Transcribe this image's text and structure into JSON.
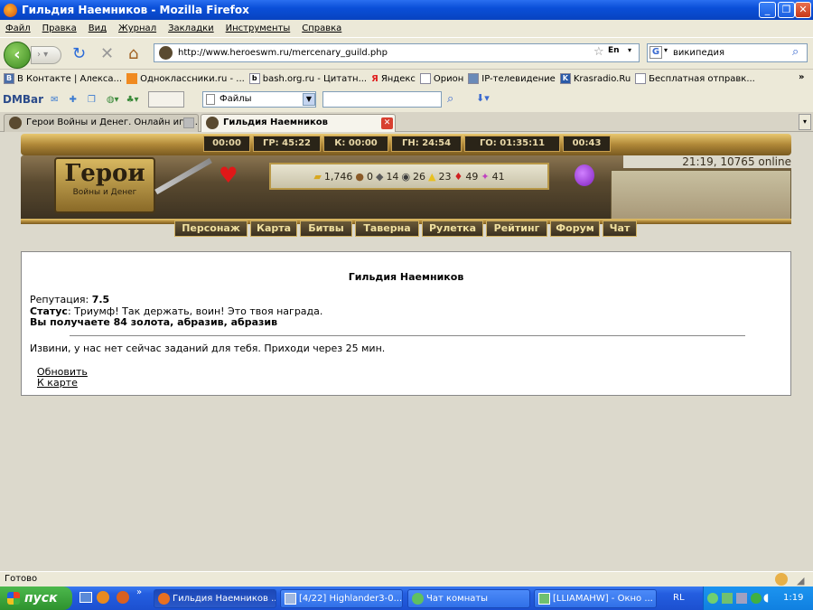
{
  "browser": {
    "title": "Гильдия Наемников - Mozilla Firefox",
    "menu": [
      "Файл",
      "Правка",
      "Вид",
      "Журнал",
      "Закладки",
      "Инструменты",
      "Справка"
    ],
    "url": "http://www.heroeswm.ru/mercenary_guild.php",
    "search_value": "википедия",
    "lang_badge": "En",
    "bookmarks": [
      "В Контакте | Алекса...",
      "Одноклассники.ru - ...",
      "bash.org.ru - Цитатн...",
      "Яндекс",
      "Орион",
      "IP-телевидение",
      "Krasradio.Ru",
      "Бесплатная отправк..."
    ],
    "dmbar_label": "DMBar",
    "files_combo": "Файлы",
    "tabs": [
      {
        "label": "Герои Войны и Денег. Онлайн игра.",
        "active": false
      },
      {
        "label": "Гильдия Наемников",
        "active": true
      }
    ],
    "status": "Готово"
  },
  "game": {
    "logo_text": "Герои",
    "logo_sub": "Войны и Денег",
    "timers": [
      "00:00",
      "ГР: 45:22",
      "К: 00:00",
      "ГН: 24:54",
      "ГО: 01:35:11",
      "00:43"
    ],
    "resources": [
      {
        "icon": "gold-icon",
        "value": "1,746"
      },
      {
        "icon": "wood-icon",
        "value": "0"
      },
      {
        "icon": "ore-icon",
        "value": "14"
      },
      {
        "icon": "mercury-icon",
        "value": "26"
      },
      {
        "icon": "sulfur-icon",
        "value": "23"
      },
      {
        "icon": "crystal-icon",
        "value": "49"
      },
      {
        "icon": "gem-icon",
        "value": "41"
      }
    ],
    "online": "21:19, 10765 online",
    "nav": [
      "Персонаж",
      "Карта",
      "Битвы",
      "Таверна",
      "Рулетка",
      "Рейтинг",
      "Форум",
      "Чат"
    ],
    "guild": {
      "title": "Гильдия Наемников",
      "reputation_label": "Репутация:",
      "reputation_value": "7.5",
      "status_label": "Статус",
      "status_text": ": Триумф! Так держать, воин! Это твоя награда.",
      "reward": "Вы получаете 84 золота, абразив, абразив",
      "message": "Извини, у нас нет сейчас заданий для тебя. Приходи через 25 мин.",
      "refresh_link": "Обновить",
      "map_link": "К карте"
    }
  },
  "taskbar": {
    "start": "пуск",
    "windows": [
      {
        "label": "Гильдия Наемников ...",
        "active": true
      },
      {
        "label": "[4/22] Highlander3-0...",
        "active": false
      },
      {
        "label": "Чат комнаты",
        "active": false
      },
      {
        "label": "[LLIAMAHW] - Окно ...",
        "active": false
      }
    ],
    "lang": "RL",
    "clock": "1:19"
  }
}
